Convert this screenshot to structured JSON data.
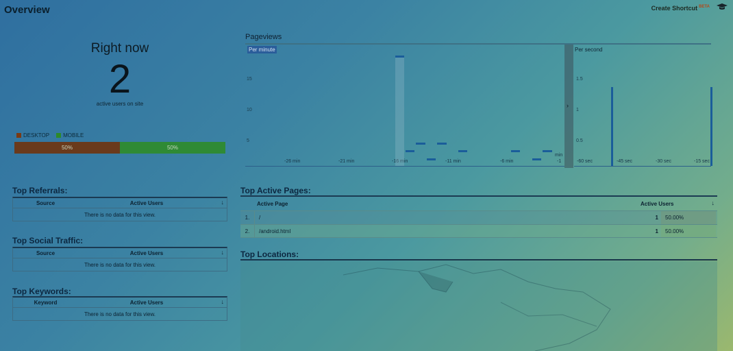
{
  "header": {
    "title": "Overview",
    "shortcut_label": "Create Shortcut",
    "shortcut_badge": "BETA",
    "shortcut_icon": "graduation-cap-icon"
  },
  "right_now": {
    "title": "Right now",
    "count": "2",
    "subtitle": "active users on site"
  },
  "device_split": {
    "legend": [
      {
        "label": "DESKTOP",
        "color": "#7a3a14"
      },
      {
        "label": "MOBILE",
        "color": "#2d8a2a"
      }
    ],
    "segments": [
      {
        "label": "50%",
        "value": 0.5,
        "color": "#6a3a1c"
      },
      {
        "label": "50%",
        "value": 0.5,
        "color": "#2f8a35"
      }
    ]
  },
  "pageviews": {
    "title": "Pageviews",
    "per_minute_label": "Per minute",
    "per_second_label": "Per second",
    "minute_yticks": [
      "15",
      "10",
      "5"
    ],
    "minute_xticks": [
      "-26 min",
      "-21 min",
      "-16 min",
      "-11 min",
      "-6 min",
      "-1",
      "min"
    ],
    "second_yticks": [
      "1.5",
      "1",
      "0.5"
    ],
    "second_xticks": [
      "-60 sec",
      "-45 sec",
      "-30 sec",
      "-15 sec"
    ]
  },
  "chart_data": [
    {
      "type": "bar",
      "title": "Per minute",
      "x": [
        -30,
        -29,
        -28,
        -27,
        -26,
        -25,
        -24,
        -23,
        -22,
        -21,
        -20,
        -19,
        -18,
        -17,
        -16,
        -15,
        -14,
        -13,
        -12,
        -11,
        -10,
        -9,
        -8,
        -7,
        -6,
        -5,
        -4,
        -3,
        -2,
        -1
      ],
      "values": [
        0,
        0,
        0,
        0,
        0,
        0,
        0,
        0,
        0,
        0,
        0,
        0,
        0,
        0,
        14,
        2,
        3,
        1,
        3,
        0,
        2,
        0,
        0,
        0,
        0,
        2,
        0,
        1,
        2,
        0
      ],
      "ylim": [
        0,
        15
      ]
    },
    {
      "type": "bar",
      "title": "Per second",
      "x": [
        -44,
        -1
      ],
      "values": [
        1,
        1
      ],
      "ylim": [
        0,
        1.5
      ]
    }
  ],
  "top_referrals": {
    "title": "Top Referrals:",
    "col1": "Source",
    "col2": "Active Users",
    "empty": "There is no data for this view."
  },
  "top_social": {
    "title": "Top Social Traffic:",
    "col1": "Source",
    "col2": "Active Users",
    "empty": "There is no data for this view."
  },
  "top_keywords": {
    "title": "Top Keywords:",
    "col1": "Keyword",
    "col2": "Active Users",
    "empty": "There is no data for this view."
  },
  "top_pages": {
    "title": "Top Active Pages:",
    "col1": "Active Page",
    "col2": "Active Users",
    "rows": [
      {
        "idx": "1.",
        "page": "/",
        "users": "1",
        "pct": "50.00%"
      },
      {
        "idx": "2.",
        "page": "/android.html",
        "users": "1",
        "pct": "50.00%"
      }
    ]
  },
  "top_locations": {
    "title": "Top Locations:"
  }
}
